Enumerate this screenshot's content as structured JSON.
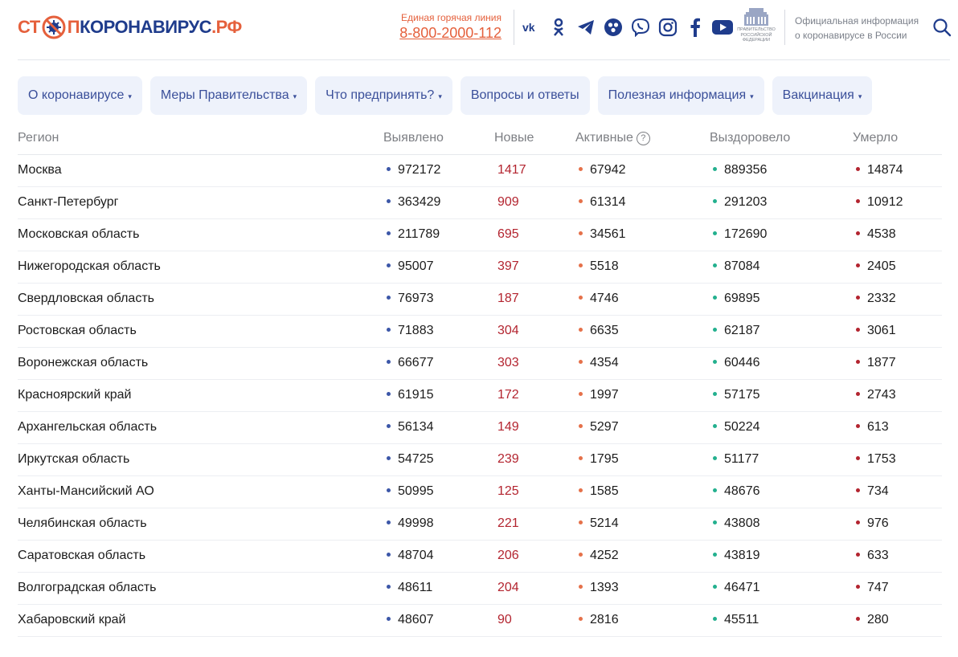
{
  "header": {
    "logo": {
      "part1": "СТ",
      "part2": "П",
      "part3": "КОРОНАВИРУС",
      "part4": ".РФ"
    },
    "hotline_label": "Единая горячая линия",
    "hotline_number": "8-800-2000-112",
    "socials": [
      {
        "icon": "vk-icon"
      },
      {
        "icon": "odnoklassniki-icon"
      },
      {
        "icon": "telegram-icon"
      },
      {
        "icon": "yandex-zen-icon"
      },
      {
        "icon": "viber-icon"
      },
      {
        "icon": "instagram-icon"
      },
      {
        "icon": "facebook-icon"
      },
      {
        "icon": "youtube-icon"
      }
    ],
    "gov_emblem_text": [
      "ПРАВИТЕЛЬСТВО",
      "РОССИЙСКОЙ",
      "ФЕДЕРАЦИИ"
    ],
    "official_info_line1": "Официальная информация",
    "official_info_line2": "о коронавирусе в России",
    "search_icon": "search-icon"
  },
  "nav": [
    {
      "label": "О коронавирусе",
      "dropdown": true
    },
    {
      "label": "Меры Правительства",
      "dropdown": true
    },
    {
      "label": "Что предпринять?",
      "dropdown": true
    },
    {
      "label": "Вопросы и ответы",
      "dropdown": false
    },
    {
      "label": "Полезная информация",
      "dropdown": true
    },
    {
      "label": "Вакцинация",
      "dropdown": true
    }
  ],
  "nav_caret": "▾",
  "table": {
    "headers": {
      "region": "Регион",
      "confirmed": "Выявлено",
      "new": "Новые",
      "active": "Активные",
      "active_help": "?",
      "recovered": "Выздоровело",
      "deaths": "Умерло"
    },
    "rows": [
      {
        "region": "Москва",
        "confirmed": "972172",
        "new": "1417",
        "active": "67942",
        "recovered": "889356",
        "deaths": "14874"
      },
      {
        "region": "Санкт-Петербург",
        "confirmed": "363429",
        "new": "909",
        "active": "61314",
        "recovered": "291203",
        "deaths": "10912"
      },
      {
        "region": "Московская область",
        "confirmed": "211789",
        "new": "695",
        "active": "34561",
        "recovered": "172690",
        "deaths": "4538"
      },
      {
        "region": "Нижегородская область",
        "confirmed": "95007",
        "new": "397",
        "active": "5518",
        "recovered": "87084",
        "deaths": "2405"
      },
      {
        "region": "Свердловская область",
        "confirmed": "76973",
        "new": "187",
        "active": "4746",
        "recovered": "69895",
        "deaths": "2332"
      },
      {
        "region": "Ростовская область",
        "confirmed": "71883",
        "new": "304",
        "active": "6635",
        "recovered": "62187",
        "deaths": "3061"
      },
      {
        "region": "Воронежская область",
        "confirmed": "66677",
        "new": "303",
        "active": "4354",
        "recovered": "60446",
        "deaths": "1877"
      },
      {
        "region": "Красноярский край",
        "confirmed": "61915",
        "new": "172",
        "active": "1997",
        "recovered": "57175",
        "deaths": "2743"
      },
      {
        "region": "Архангельская область",
        "confirmed": "56134",
        "new": "149",
        "active": "5297",
        "recovered": "50224",
        "deaths": "613"
      },
      {
        "region": "Иркутская область",
        "confirmed": "54725",
        "new": "239",
        "active": "1795",
        "recovered": "51177",
        "deaths": "1753"
      },
      {
        "region": "Ханты-Мансийский АО",
        "confirmed": "50995",
        "new": "125",
        "active": "1585",
        "recovered": "48676",
        "deaths": "734"
      },
      {
        "region": "Челябинская область",
        "confirmed": "49998",
        "new": "221",
        "active": "5214",
        "recovered": "43808",
        "deaths": "976"
      },
      {
        "region": "Саратовская область",
        "confirmed": "48704",
        "new": "206",
        "active": "4252",
        "recovered": "43819",
        "deaths": "633"
      },
      {
        "region": "Волгоградская область",
        "confirmed": "48611",
        "new": "204",
        "active": "1393",
        "recovered": "46471",
        "deaths": "747"
      },
      {
        "region": "Хабаровский край",
        "confirmed": "48607",
        "new": "90",
        "active": "2816",
        "recovered": "45511",
        "deaths": "280"
      }
    ]
  },
  "colors": {
    "accent_red": "#e5603c",
    "brand_blue": "#1f3c8c",
    "confirmed_dot": "#3c57a8",
    "active_dot": "#e5714a",
    "recovered_dot": "#23b08e",
    "deaths_dot": "#b3242f",
    "nav_bg": "#eef2fb"
  }
}
